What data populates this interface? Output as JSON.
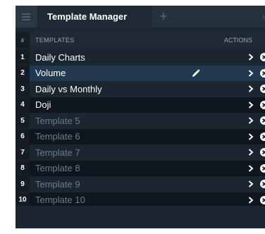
{
  "tabbar": {
    "menu_icon": "hamburger-icon",
    "active_tab_label": "Template Manager",
    "add_tab_label": "+",
    "right_edge_glyph": "›"
  },
  "table": {
    "header": {
      "index_label": "#",
      "templates_label": "TEMPLATES",
      "actions_label": "ACTIONS"
    },
    "rows": [
      {
        "index": "1",
        "name": "Daily Charts",
        "state": "named"
      },
      {
        "index": "2",
        "name": "Volume",
        "state": "selected",
        "editing_icon": "pencil-icon"
      },
      {
        "index": "3",
        "name": "Daily vs Monthly",
        "state": "named"
      },
      {
        "index": "4",
        "name": "Doji",
        "state": "named"
      },
      {
        "index": "5",
        "name": "Template 5",
        "state": "empty"
      },
      {
        "index": "6",
        "name": "Template 6",
        "state": "empty"
      },
      {
        "index": "7",
        "name": "Template 7",
        "state": "empty"
      },
      {
        "index": "8",
        "name": "Template 8",
        "state": "empty"
      },
      {
        "index": "9",
        "name": "Template 9",
        "state": "empty"
      },
      {
        "index": "10",
        "name": "Template 10",
        "state": "empty"
      }
    ],
    "action_icons": [
      "chevron-right-icon",
      "close-circle-icon"
    ]
  },
  "colors": {
    "panel_bg": "#1c2630",
    "selected_row": "#213a52",
    "empty_text": "#6e7a85",
    "text": "#ffffff"
  }
}
